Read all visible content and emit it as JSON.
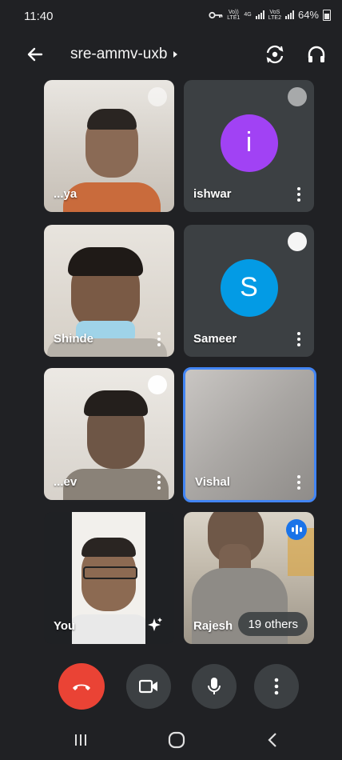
{
  "status_bar": {
    "time": "11:40",
    "sim1_label_top": "Vo))",
    "sim1_label_bottom": "LTE1",
    "sim1_network": "4G",
    "sim2_label_top": "VoS",
    "sim2_label_bottom": "LTE2",
    "battery": "64%"
  },
  "header": {
    "meeting_code": "sre-ammv-uxb"
  },
  "tiles": [
    {
      "name": "...ya",
      "type": "video",
      "muted": true
    },
    {
      "name": "ishwar",
      "type": "avatar",
      "initial": "i",
      "avatar_color": "#a142f4",
      "muted": true
    },
    {
      "name": "Shinde",
      "type": "video",
      "muted": false
    },
    {
      "name": "Sameer",
      "type": "avatar",
      "initial": "S",
      "avatar_color": "#039be5",
      "muted": true
    },
    {
      "name": "...ev",
      "type": "video",
      "muted": true
    },
    {
      "name": "Vishal",
      "type": "video",
      "muted": false,
      "active": true
    },
    {
      "name": "You",
      "type": "self-view"
    },
    {
      "name": "Rajesh",
      "type": "video",
      "speaking": true,
      "others_label": "19 others"
    }
  ],
  "controls": {
    "end_call_color": "#ea4335",
    "button_color": "#3c4043"
  },
  "accent_color": "#4285f4"
}
